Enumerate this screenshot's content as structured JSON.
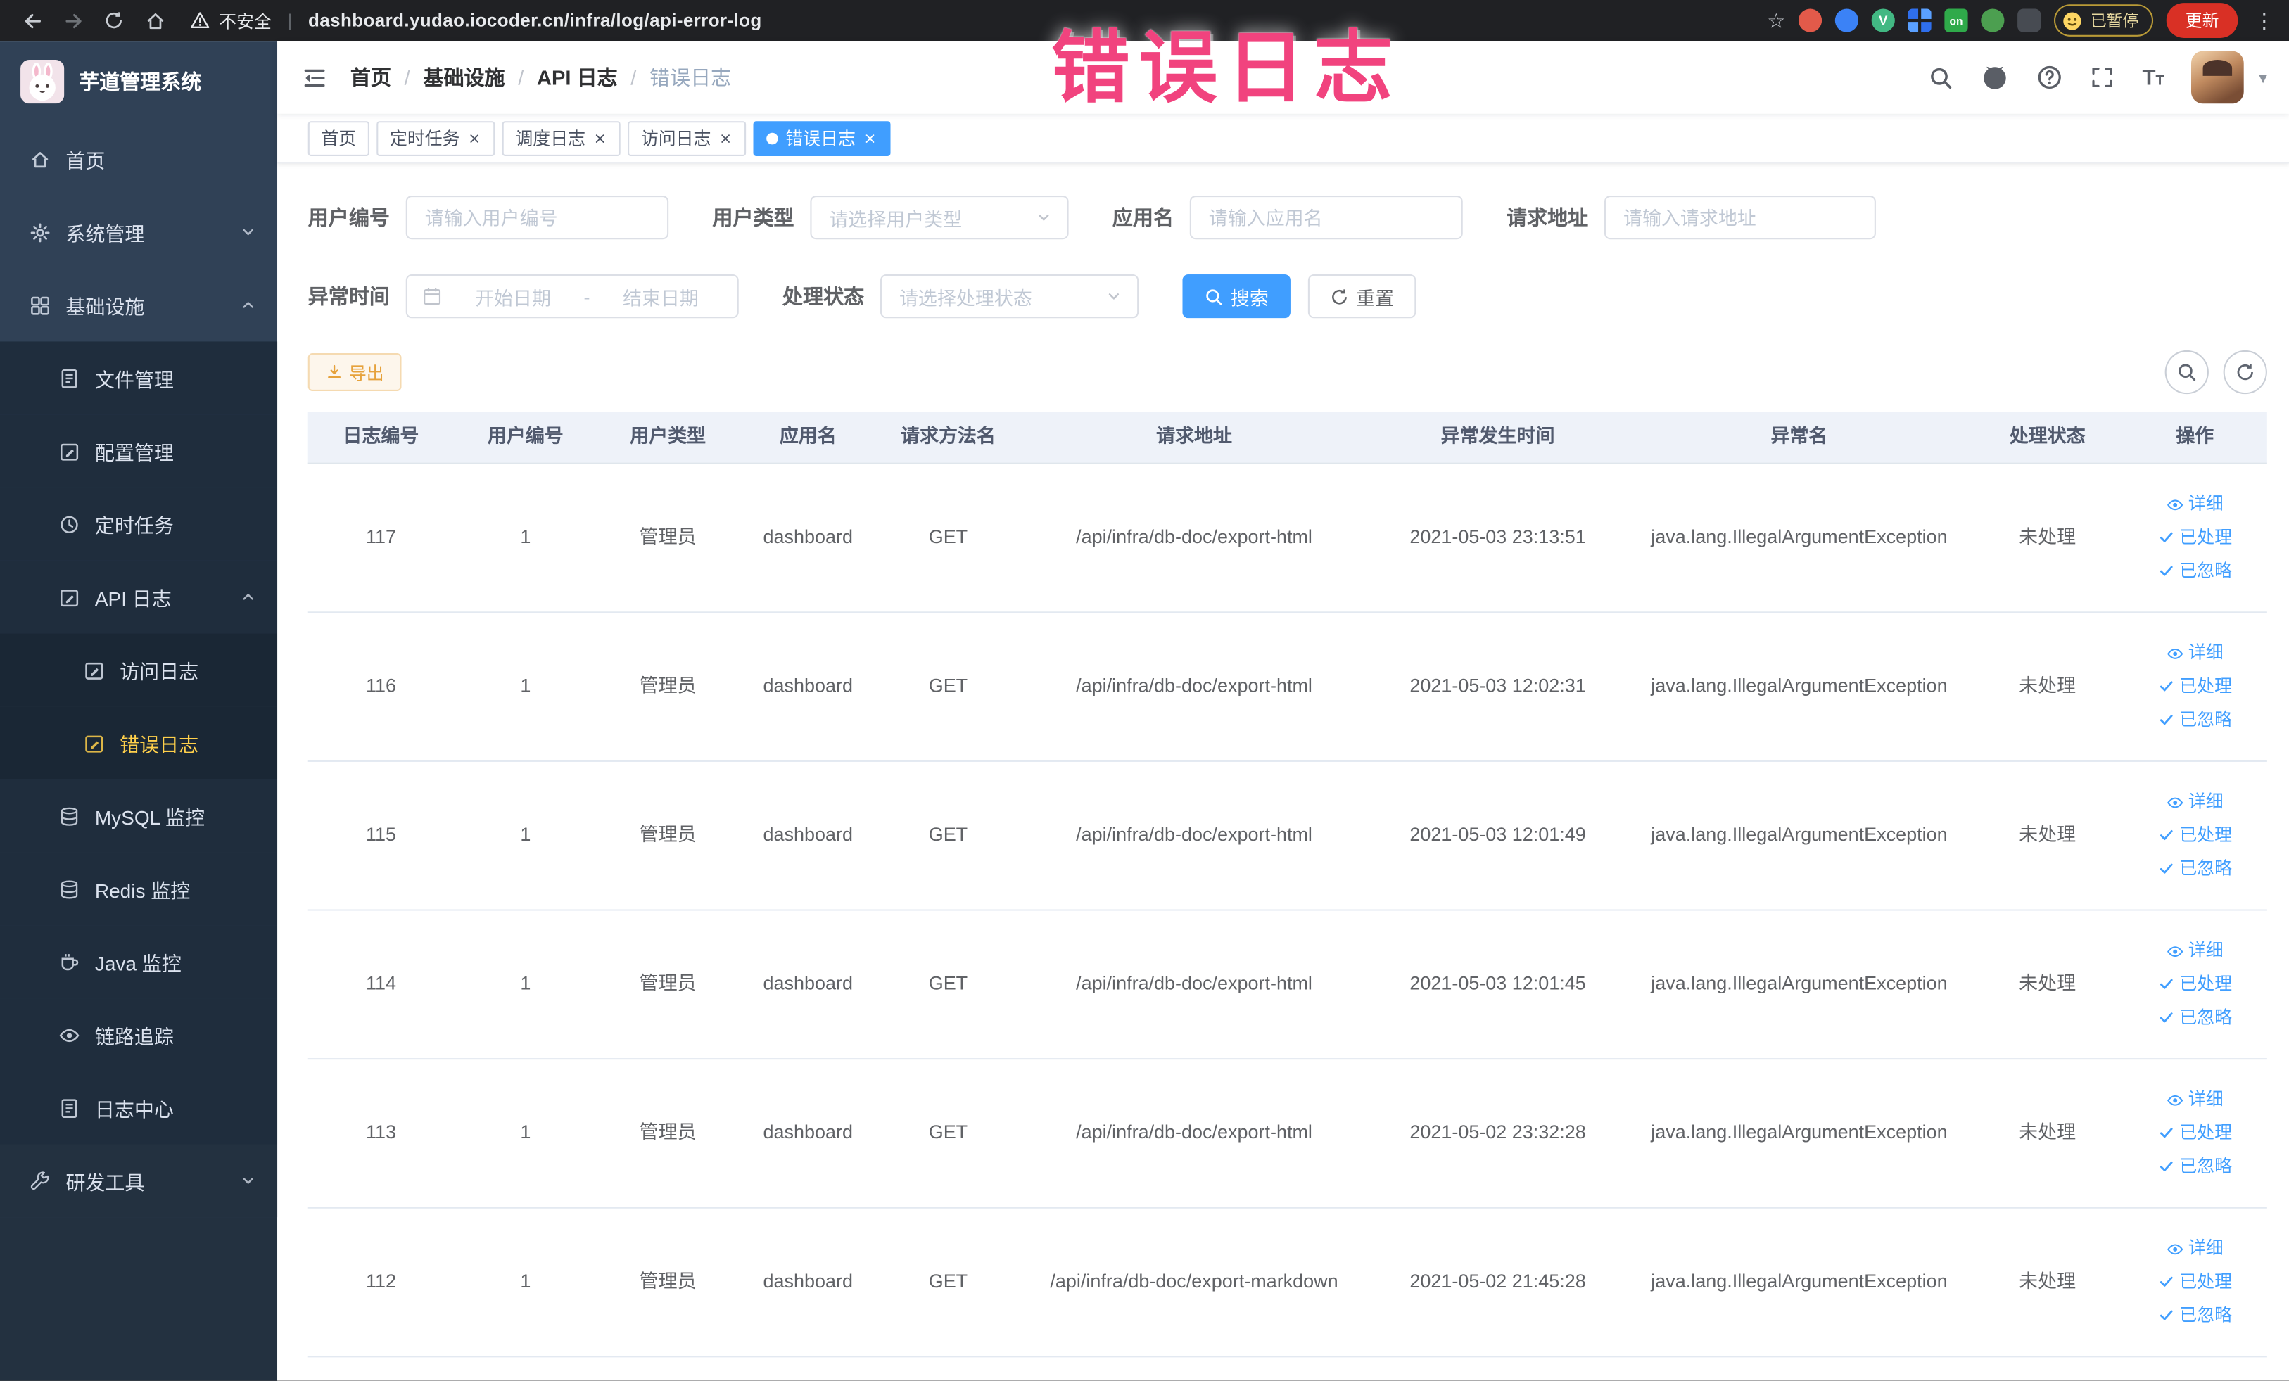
{
  "colors": {
    "primary": "#409eff",
    "sidebar_bg": "#304156",
    "submenu_bg": "#1f2d3d",
    "sidebar_active": "#ffd04b",
    "warning_text": "#e6a23c",
    "warning_bg": "#fdf6ec",
    "warning_border": "#f5dab1",
    "table_header_bg": "#eef2f9",
    "annotation_pink": "#f1437e",
    "update_button_bg": "#d93025"
  },
  "annotation": {
    "text": "错误日志"
  },
  "browser": {
    "nav_icons": [
      "back",
      "forward",
      "reload",
      "home"
    ],
    "security_label": "不安全",
    "url": "dashboard.yudao.iocoder.cn/infra/log/api-error-log",
    "extension_icons": [
      "extension-red",
      "extension-blue",
      "vue-devtools",
      "extension-grid",
      "extension-on",
      "extension-green",
      "extension-dark",
      "tampermonkey-smiley"
    ],
    "vue_devtools_letter": "V",
    "extension_on_badge": "on",
    "paused_badge": "已暂停",
    "update_button": "更新"
  },
  "sidebar": {
    "logo_title": "芋道管理系统",
    "menu": [
      {
        "key": "home",
        "label": "首页",
        "icon": "home",
        "level": 1
      },
      {
        "key": "system-management",
        "label": "系统管理",
        "icon": "gear",
        "level": 1,
        "arrow": "down"
      },
      {
        "key": "infrastructure",
        "label": "基础设施",
        "icon": "grid",
        "level": 1,
        "arrow": "up"
      },
      {
        "key": "file-management",
        "label": "文件管理",
        "icon": "doc",
        "level": 2
      },
      {
        "key": "config-management",
        "label": "配置管理",
        "icon": "edit",
        "level": 2
      },
      {
        "key": "scheduled-tasks",
        "label": "定时任务",
        "icon": "clock",
        "level": 2
      },
      {
        "key": "api-logs",
        "label": "API 日志",
        "icon": "edit",
        "level": 2,
        "arrow": "up"
      },
      {
        "key": "access-logs",
        "label": "访问日志",
        "icon": "edit",
        "level": 3
      },
      {
        "key": "error-logs",
        "label": "错误日志",
        "icon": "edit",
        "level": 3,
        "active": true
      },
      {
        "key": "mysql-monitor",
        "label": "MySQL 监控",
        "icon": "db",
        "level": 2
      },
      {
        "key": "redis-monitor",
        "label": "Redis 监控",
        "icon": "db",
        "level": 2
      },
      {
        "key": "java-monitor",
        "label": "Java 监控",
        "icon": "coffee",
        "level": 2
      },
      {
        "key": "link-tracing",
        "label": "链路追踪",
        "icon": "eye",
        "level": 2
      },
      {
        "key": "log-center",
        "label": "日志中心",
        "icon": "doc",
        "level": 2
      },
      {
        "key": "dev-tools",
        "label": "研发工具",
        "icon": "wrench",
        "level": 1,
        "arrow": "down",
        "dark": true
      }
    ]
  },
  "header": {
    "breadcrumb": [
      "首页",
      "基础设施",
      "API 日志",
      "错误日志"
    ],
    "icons": [
      "search",
      "github",
      "question",
      "fullscreen",
      "font-size",
      "avatar",
      "caret-down"
    ]
  },
  "tabs": [
    {
      "key": "home",
      "label": "首页",
      "closable": false,
      "active": false
    },
    {
      "key": "scheduled-tasks",
      "label": "定时任务",
      "closable": true,
      "active": false
    },
    {
      "key": "schedule-logs",
      "label": "调度日志",
      "closable": true,
      "active": false
    },
    {
      "key": "access-logs",
      "label": "访问日志",
      "closable": true,
      "active": false
    },
    {
      "key": "error-logs",
      "label": "错误日志",
      "closable": true,
      "active": true
    }
  ],
  "filters": {
    "user_id": {
      "label": "用户编号",
      "placeholder": "请输入用户编号"
    },
    "user_type": {
      "label": "用户类型",
      "placeholder": "请选择用户类型"
    },
    "app_name": {
      "label": "应用名",
      "placeholder": "请输入应用名"
    },
    "request_url": {
      "label": "请求地址",
      "placeholder": "请输入请求地址"
    },
    "exception_time": {
      "label": "异常时间",
      "start_placeholder": "开始日期",
      "separator": "-",
      "end_placeholder": "结束日期"
    },
    "process_status": {
      "label": "处理状态",
      "placeholder": "请选择处理状态"
    },
    "search_button": "搜索",
    "reset_button": "重置"
  },
  "toolbar": {
    "export_button": "导出",
    "right_icons": [
      "search",
      "refresh"
    ]
  },
  "table": {
    "columns": [
      "日志编号",
      "用户编号",
      "用户类型",
      "应用名",
      "请求方法名",
      "请求地址",
      "异常发生时间",
      "异常名",
      "处理状态",
      "操作"
    ],
    "action_labels": [
      "详细",
      "已处理",
      "已忽略"
    ],
    "action_icons": [
      "eye",
      "check",
      "check"
    ],
    "rows": [
      {
        "id": "117",
        "user_id": "1",
        "user_type": "管理员",
        "app": "dashboard",
        "method": "GET",
        "url": "/api/infra/db-doc/export-html",
        "time": "2021-05-03 23:13:51",
        "exception": "java.lang.IllegalArgumentException",
        "status": "未处理"
      },
      {
        "id": "116",
        "user_id": "1",
        "user_type": "管理员",
        "app": "dashboard",
        "method": "GET",
        "url": "/api/infra/db-doc/export-html",
        "time": "2021-05-03 12:02:31",
        "exception": "java.lang.IllegalArgumentException",
        "status": "未处理"
      },
      {
        "id": "115",
        "user_id": "1",
        "user_type": "管理员",
        "app": "dashboard",
        "method": "GET",
        "url": "/api/infra/db-doc/export-html",
        "time": "2021-05-03 12:01:49",
        "exception": "java.lang.IllegalArgumentException",
        "status": "未处理"
      },
      {
        "id": "114",
        "user_id": "1",
        "user_type": "管理员",
        "app": "dashboard",
        "method": "GET",
        "url": "/api/infra/db-doc/export-html",
        "time": "2021-05-03 12:01:45",
        "exception": "java.lang.IllegalArgumentException",
        "status": "未处理"
      },
      {
        "id": "113",
        "user_id": "1",
        "user_type": "管理员",
        "app": "dashboard",
        "method": "GET",
        "url": "/api/infra/db-doc/export-html",
        "time": "2021-05-02 23:32:28",
        "exception": "java.lang.IllegalArgumentException",
        "status": "未处理"
      },
      {
        "id": "112",
        "user_id": "1",
        "user_type": "管理员",
        "app": "dashboard",
        "method": "GET",
        "url": "/api/infra/db-doc/export-markdown",
        "time": "2021-05-02 21:45:28",
        "exception": "java.lang.IllegalArgumentException",
        "status": "未处理"
      }
    ]
  }
}
